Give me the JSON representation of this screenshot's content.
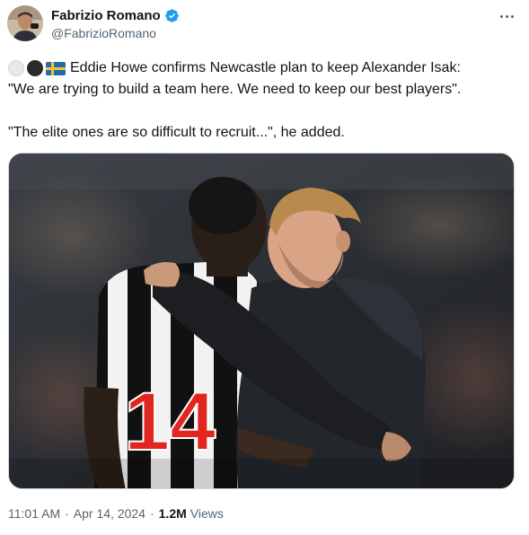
{
  "author": {
    "name": "Fabrizio Romano",
    "handle": "@FabrizioRomano",
    "verified": true
  },
  "tweet": {
    "line1": "Eddie Howe confirms Newcastle plan to keep Alexander Isak:",
    "line2": "\"We are trying to build a team here. We need to keep our best players\".",
    "line3": "\"The elite ones are so difficult to recruit...\", he added.",
    "emojis": [
      "white-circle-icon",
      "black-circle-icon",
      "sweden-flag-icon"
    ]
  },
  "photo": {
    "shirt_number": "14"
  },
  "meta": {
    "time": "11:01 AM",
    "separator": "·",
    "date": "Apr 14, 2024",
    "views_count": "1.2M",
    "views_label": "Views"
  },
  "colors": {
    "text": "#0f1419",
    "secondary": "#536471",
    "verified": "#1d9bf0",
    "shirt_number": "#e2261f"
  }
}
